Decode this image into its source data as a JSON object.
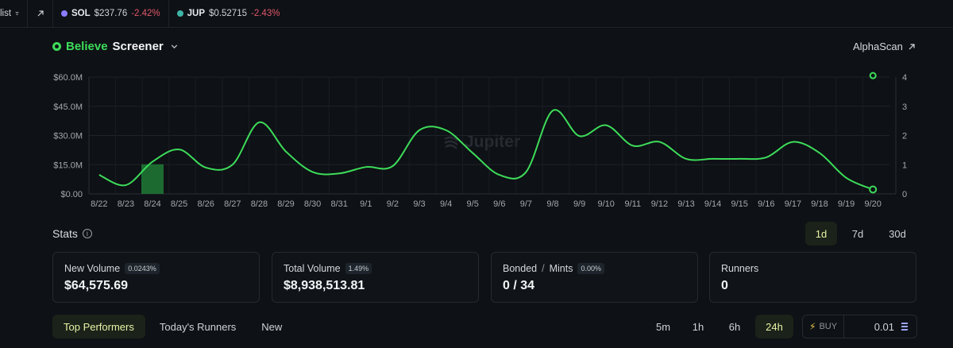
{
  "ticker": {
    "first_label": "list",
    "items": [
      {
        "symbol": "SOL",
        "price": "$237.76",
        "change": "-2.42%",
        "coin_color": "#8a7dff"
      },
      {
        "symbol": "JUP",
        "price": "$0.52715",
        "change": "-2.43%",
        "coin_color": "#3fb4a8"
      }
    ]
  },
  "header": {
    "brand": "Believe",
    "title": "Screener",
    "alphascan": "AlphaScan"
  },
  "watermark": "Jupiter",
  "chart_data": {
    "type": "line",
    "x": [
      "8/22",
      "8/23",
      "8/24",
      "8/25",
      "8/26",
      "8/27",
      "8/28",
      "8/29",
      "8/30",
      "8/31",
      "9/1",
      "9/2",
      "9/3",
      "9/4",
      "9/5",
      "9/6",
      "9/7",
      "9/8",
      "9/9",
      "9/10",
      "9/11",
      "9/12",
      "9/13",
      "9/14",
      "9/15",
      "9/16",
      "9/17",
      "9/18",
      "9/19",
      "9/20"
    ],
    "y_left_ticks": [
      "$60.0M",
      "$45.0M",
      "$30.0M",
      "$15.0M",
      "$0.00"
    ],
    "y_left_range": [
      0,
      60
    ],
    "y_right_ticks": [
      "4",
      "3",
      "2",
      "1",
      "0"
    ],
    "y_right_range": [
      0,
      4
    ],
    "series": [
      {
        "axis": "right",
        "color": "#3ddc5a",
        "values": [
          0.65,
          0.3,
          1.1,
          1.52,
          0.9,
          1.0,
          2.45,
          1.45,
          0.75,
          0.7,
          0.92,
          0.95,
          2.18,
          2.18,
          1.4,
          0.65,
          0.75,
          2.85,
          1.98,
          2.35,
          1.65,
          1.78,
          1.2,
          1.2,
          1.2,
          1.25,
          1.78,
          1.4,
          0.55,
          0.15
        ],
        "highlight_last": true
      },
      {
        "type": "bar",
        "axis": "left",
        "color": "#1f7a34",
        "categories": [
          "8/24"
        ],
        "values": [
          15.2
        ]
      },
      {
        "type": "marker",
        "axis": "right",
        "x": "9/20",
        "value": 4.05
      }
    ],
    "grid": true
  },
  "stats": {
    "title": "Stats",
    "periods": [
      {
        "label": "1d",
        "active": true
      },
      {
        "label": "7d",
        "active": false
      },
      {
        "label": "30d",
        "active": false
      }
    ],
    "cards": [
      {
        "label": "New Volume",
        "pill": "0.0243%",
        "value": "$64,575.69"
      },
      {
        "label": "Total Volume",
        "pill": "1.49%",
        "value": "$8,938,513.81"
      },
      {
        "label": "Bonded",
        "label2": "Mints",
        "pill": "0.00%",
        "value": "0 / 34"
      },
      {
        "label": "Runners",
        "pill": "",
        "value": "0"
      }
    ]
  },
  "tabs": [
    {
      "label": "Top Performers",
      "active": true
    },
    {
      "label": "Today's Runners",
      "active": false
    },
    {
      "label": "New",
      "active": false
    }
  ],
  "timeframes": [
    {
      "label": "5m",
      "active": false
    },
    {
      "label": "1h",
      "active": false
    },
    {
      "label": "6h",
      "active": false
    },
    {
      "label": "24h",
      "active": true
    }
  ],
  "buy": {
    "label": "BUY",
    "value": "0.01"
  }
}
